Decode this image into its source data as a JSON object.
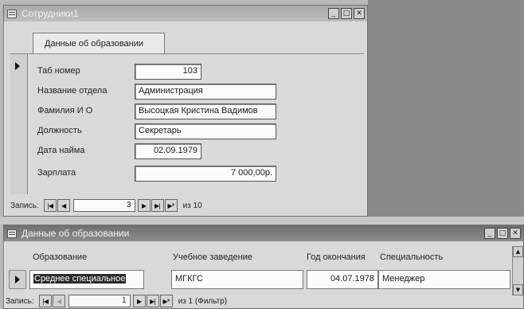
{
  "form_window": {
    "title": "Сотрудники1",
    "tab_label": "Данные об образовании",
    "fields": {
      "tab_number": {
        "label": "Таб номер",
        "value": "103"
      },
      "department": {
        "label": "Название отдела",
        "value": "Администрация"
      },
      "full_name": {
        "label": "Фамилия И О",
        "value": "Высоцкая Кристина Вадимов"
      },
      "position": {
        "label": "Должность",
        "value": "Секретарь"
      },
      "hire_date": {
        "label": "Дата найма",
        "value": "02.09.1979"
      },
      "salary": {
        "label": "Зарплата",
        "value": "7 000,00р."
      }
    },
    "nav": {
      "label": "Запись:",
      "current": "3",
      "of_text": "из 10"
    }
  },
  "sheet_window": {
    "title": "Данные об образовании",
    "columns": [
      "Образование",
      "Учебное заведение",
      "Год окончания",
      "Специальность"
    ],
    "row": {
      "education": "Среднее специальное",
      "institution": "МГКГС",
      "grad_year": "04.07.1978",
      "specialty": "Менеджер"
    },
    "nav": {
      "label": "Запись:",
      "current": "1",
      "of_text": "из 1 (Фильтр)"
    }
  },
  "glyphs": {
    "first": "|◀",
    "prev": "◀",
    "next": "▶",
    "last": "▶|",
    "new": "▶*",
    "minimize": "_",
    "maximize": "□",
    "close": "✕",
    "scroll_up": "▲",
    "scroll_down": "▼"
  }
}
